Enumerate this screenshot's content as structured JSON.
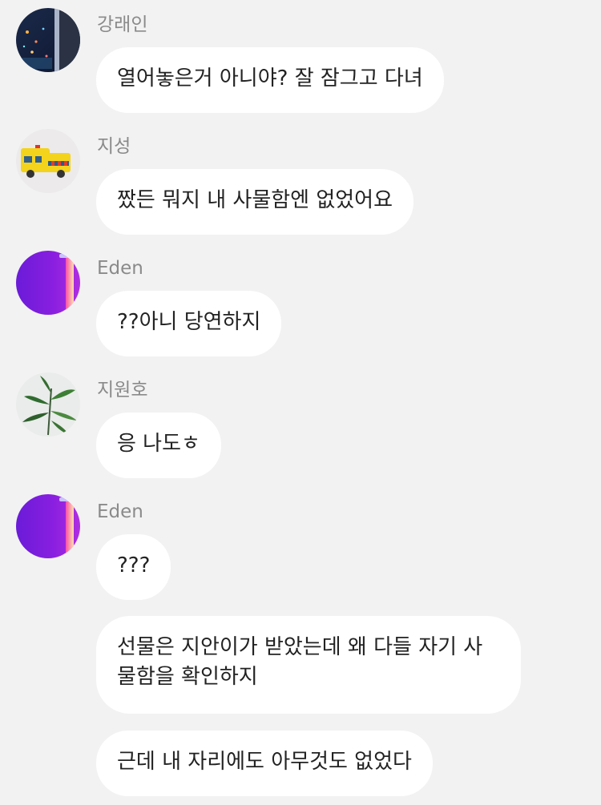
{
  "messages": [
    {
      "sender": "강래인",
      "avatar_icon": "night-window-avatar",
      "bubbles": [
        "열어놓은거 아니야? 잘 잠그고 다녀"
      ]
    },
    {
      "sender": "지성",
      "avatar_icon": "ambulance-avatar",
      "bubbles": [
        "짰든 뭐지 내 사물함엔 없었어요"
      ]
    },
    {
      "sender": "Eden",
      "avatar_icon": "purple-neon-avatar",
      "bubbles": [
        "??아니 당연하지"
      ]
    },
    {
      "sender": "지원호",
      "avatar_icon": "plant-leaves-avatar",
      "bubbles": [
        "응 나도ㅎ"
      ]
    },
    {
      "sender": "Eden",
      "avatar_icon": "purple-neon-avatar",
      "bubbles": [
        "???",
        "선물은 지안이가 받았는데  왜 다들 자기 사물함을 확인하지",
        "근데 내 자리에도 아무것도 없었다"
      ]
    }
  ],
  "colors": {
    "background": "#f2f2f2",
    "bubble": "#ffffff",
    "sender_text": "#8a8a8a",
    "message_text": "#222222"
  }
}
